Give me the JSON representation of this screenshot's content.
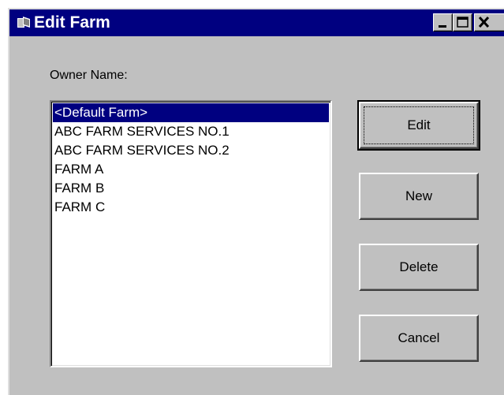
{
  "window": {
    "title": "Edit Farm",
    "titlebar_color": "#000080",
    "icon": "app-window-icon",
    "controls": [
      "minimize-icon",
      "maximize-icon",
      "close-icon"
    ]
  },
  "owner_label": "Owner Name:",
  "owner_list": {
    "items": [
      "<Default Farm>",
      "ABC FARM SERVICES NO.1",
      "ABC FARM SERVICES NO.2",
      "FARM A",
      "FARM B",
      "FARM C"
    ],
    "selected_index": 0
  },
  "buttons": {
    "edit": "Edit",
    "new": "New",
    "delete": "Delete",
    "cancel": "Cancel"
  }
}
